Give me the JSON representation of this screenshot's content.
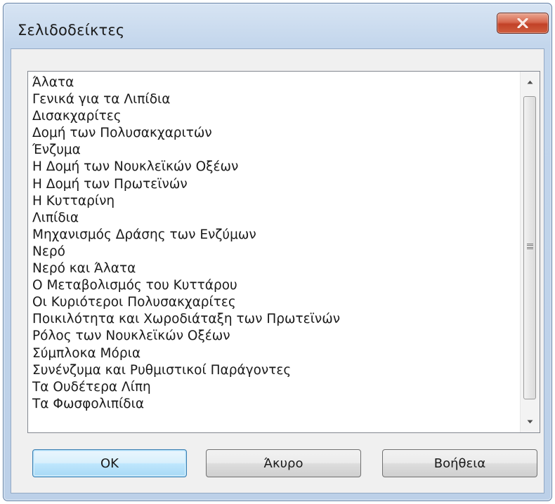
{
  "window": {
    "title": "Σελιδοδείκτες"
  },
  "bookmarks": {
    "items": [
      "Άλατα",
      "Γενικά για τα Λιπίδια",
      "Δισακχαρίτες",
      "Δομή των Πολυσακχαριτών",
      "Ένζυμα",
      "Η Δομή των Νουκλεϊκών Οξέων",
      "Η Δομή των Πρωτεϊνών",
      "Η Κυτταρίνη",
      "Λιπίδια",
      "Μηχανισμός Δράσης των Ενζύμων",
      "Νερό",
      "Νερό και Άλατα",
      "Ο Μεταβολισμός του Κυττάρου",
      "Οι Κυριότεροι Πολυσακχαρίτες",
      "Ποικιλότητα και Χωροδιάταξη των Πρωτεϊνών",
      "Ρόλος των Νουκλεϊκών Οξέων",
      "Σύμπλοκα Μόρια",
      "Συνένζυμα και Ρυθμιστικοί Παράγοντες",
      "Τα Ουδέτερα Λίπη",
      "Τα Φωσφολιπίδια"
    ]
  },
  "buttons": {
    "ok": "OK",
    "cancel": "Άκυρο",
    "help": "Βοήθεια"
  },
  "icons": {
    "close": "close-icon",
    "scroll_up": "scroll-up-arrow-icon",
    "scroll_down": "scroll-down-arrow-icon",
    "grip": "scrollbar-grip-icon"
  },
  "colors": {
    "close_button": "#c8492d",
    "window_frame": "#bcd0e8",
    "default_button_border": "#3c7fb1"
  }
}
